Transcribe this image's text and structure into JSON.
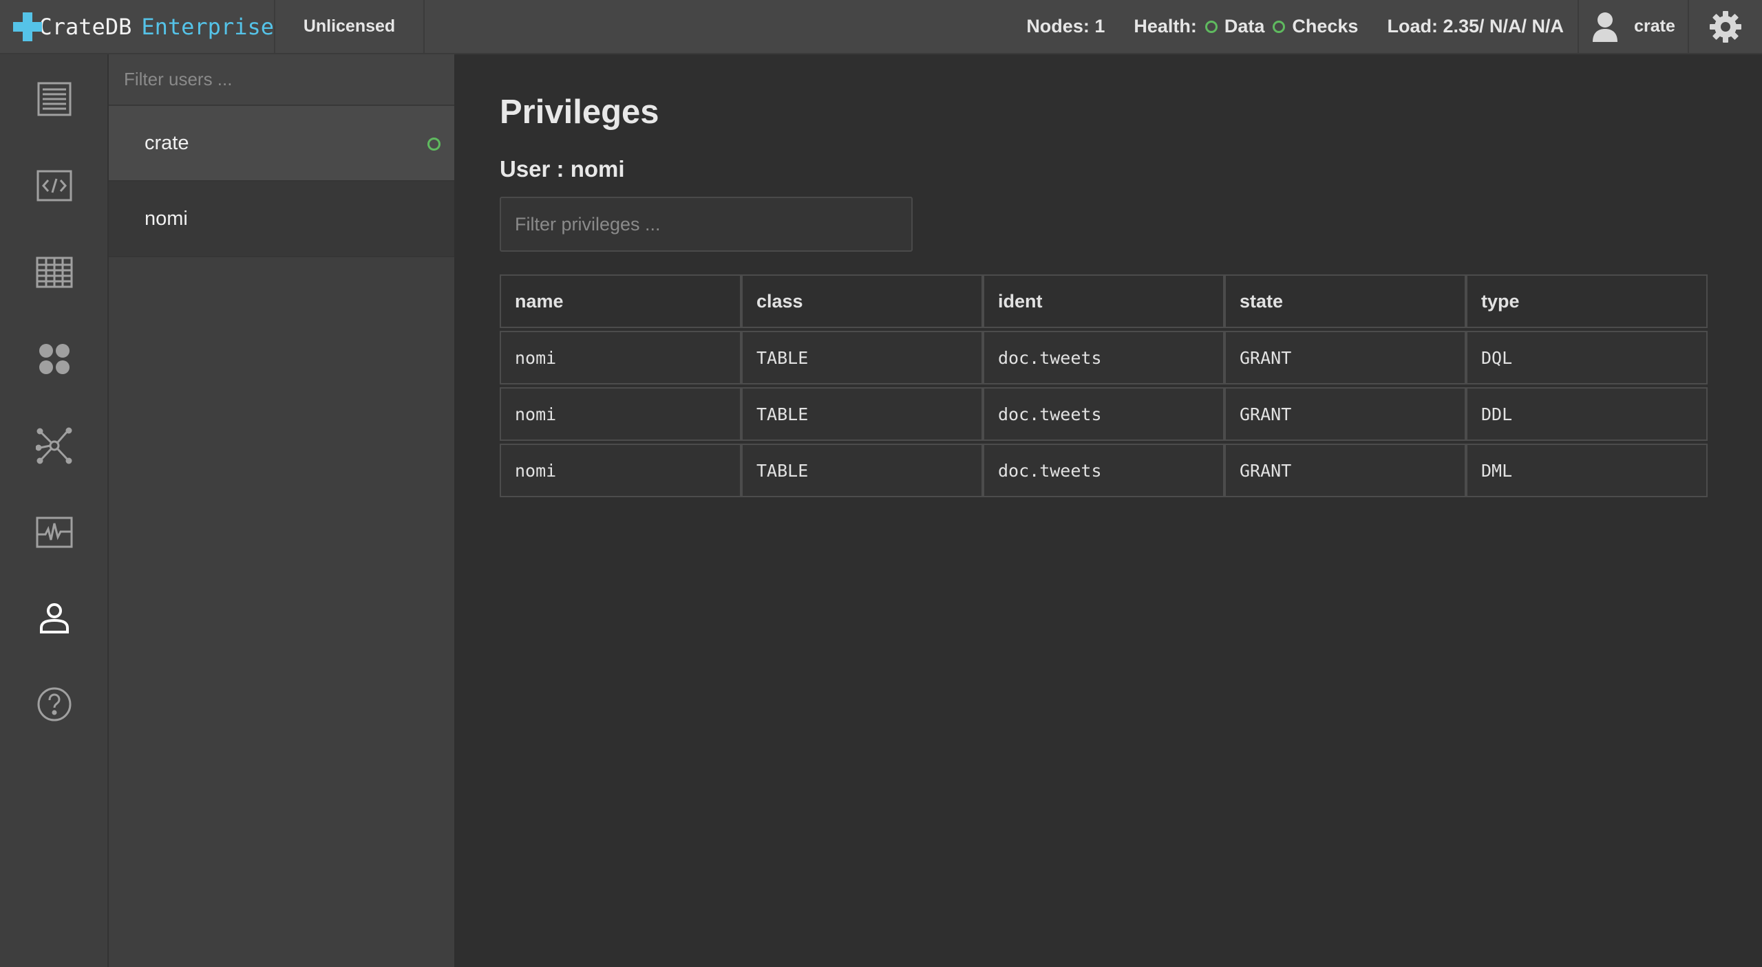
{
  "app": {
    "brand_name": "CrateDB",
    "brand_edition": "Enterprise",
    "license": "Unlicensed"
  },
  "status": {
    "nodes": "Nodes: 1",
    "health_label": "Health:",
    "health_data": "Data",
    "health_checks": "Checks",
    "load": "Load: 2.35/ N/A/ N/A"
  },
  "current_user": "crate",
  "colors": {
    "accent": "#55c3e8",
    "health_ok": "#5fba5f",
    "background": "#2f2f2f"
  },
  "nav": [
    {
      "name": "overview-icon"
    },
    {
      "name": "console-icon"
    },
    {
      "name": "tables-icon"
    },
    {
      "name": "views-icon"
    },
    {
      "name": "cluster-icon"
    },
    {
      "name": "monitoring-icon"
    },
    {
      "name": "users-icon",
      "active": true
    },
    {
      "name": "help-icon"
    }
  ],
  "users_panel": {
    "filter_placeholder": "Filter users ...",
    "users": [
      {
        "name": "crate",
        "online": true
      },
      {
        "name": "nomi",
        "online": false
      }
    ]
  },
  "main": {
    "title": "Privileges",
    "subtitle": "User : nomi",
    "filter_placeholder": "Filter privileges ...",
    "columns": [
      "name",
      "class",
      "ident",
      "state",
      "type"
    ],
    "rows": [
      [
        "nomi",
        "TABLE",
        "doc.tweets",
        "GRANT",
        "DQL"
      ],
      [
        "nomi",
        "TABLE",
        "doc.tweets",
        "GRANT",
        "DDL"
      ],
      [
        "nomi",
        "TABLE",
        "doc.tweets",
        "GRANT",
        "DML"
      ]
    ]
  }
}
